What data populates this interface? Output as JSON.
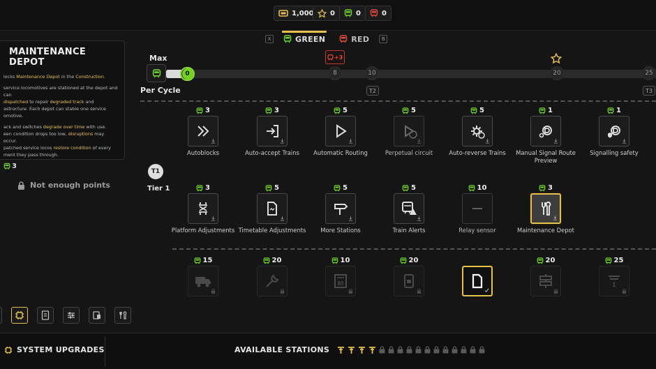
{
  "resources": {
    "coins": "1,000",
    "stars": "0",
    "green_points": "0",
    "red_points": "0"
  },
  "tabs": [
    {
      "key": "X",
      "label": "GREEN",
      "active": true
    },
    {
      "key": "B",
      "label": "RED",
      "active": false
    }
  ],
  "detail": {
    "title": "MAINTENANCE DEPOT",
    "p1_a": "locks ",
    "p1_hl": "Maintenance Depot",
    "p1_b": " in the ",
    "p1_hl2": "Construction",
    "p1_c": ".",
    "p2_a": "service locomotives are stationed at the depot and can",
    "p2_hl": "dispatched",
    "p2_b": " to repair ",
    "p2_hl2": "degraded track",
    "p2_c": " and",
    "p2_d": "astructure. Each depot can stable one service",
    "p2_e": "omotive.",
    "p3_a": "ack and switches ",
    "p3_hl": "degrade over time",
    "p3_b": " with use.",
    "p3_c": "een condition drops too low, ",
    "p3_hl2": "disruptions",
    "p3_d": " may occur.",
    "p3_e": "patched service locos ",
    "p3_hl3": "restore condition",
    "p3_f": " of every",
    "p3_g": "ment they pass through.",
    "cost": "3",
    "status": "Not enough points"
  },
  "progress": {
    "max_label": "Max",
    "per_cycle_label": "Per Cycle",
    "current": "0",
    "bonus": "+3",
    "ticks": [
      "8",
      "10",
      "20",
      "25"
    ],
    "tier_badges": [
      "T2",
      "T3"
    ]
  },
  "tier": {
    "badge": "T1",
    "label": "Tier 1"
  },
  "row1": [
    {
      "cost": "3",
      "label": "Autoblocks",
      "icon": "chevrons-icon"
    },
    {
      "cost": "3",
      "label": "Auto-accept Trains",
      "icon": "enter-icon"
    },
    {
      "cost": "5",
      "label": "Automatic Routing",
      "icon": "play-icon"
    },
    {
      "cost": "5",
      "label": "Perpetual circuit",
      "icon": "loop-play-icon"
    },
    {
      "cost": "5",
      "label": "Auto-reverse Trains",
      "icon": "gear-reverse-icon"
    },
    {
      "cost": "1",
      "label": "Manual Signal Route Preview",
      "icon": "signal-route-icon"
    },
    {
      "cost": "1",
      "label": "Signalling safety",
      "icon": "shield-signal-icon"
    }
  ],
  "row2": [
    {
      "cost": "3",
      "label": "Platform Adjustments",
      "icon": "shuffle-icon"
    },
    {
      "cost": "5",
      "label": "Timetable Adjustments",
      "icon": "document-icon"
    },
    {
      "cost": "5",
      "label": "More Stations",
      "icon": "signpost-icon"
    },
    {
      "cost": "5",
      "label": "Train Alerts",
      "icon": "train-alert-icon"
    },
    {
      "cost": "10",
      "label": "Relay sensor",
      "icon": "dash-icon"
    },
    {
      "cost": "3",
      "label": "Maintenance Depot",
      "icon": "wrench-icon"
    }
  ],
  "row3": [
    {
      "cost": "15",
      "icon": "truck-icon"
    },
    {
      "cost": "20",
      "icon": "wrench-icon"
    },
    {
      "cost": "10",
      "icon": "speed-80-icon"
    },
    {
      "cost": "20",
      "icon": "phone-icon"
    },
    {
      "cost": "",
      "icon": "document-icon"
    },
    {
      "cost": "20",
      "icon": "signpost-icon"
    },
    {
      "cost": "25",
      "icon": "platform-1-icon"
    }
  ],
  "bottom": {
    "system_upgrades": "SYSTEM UPGRADES",
    "available_stations": "AVAILABLE STATIONS",
    "stations_unlocked": 4,
    "stations_locked": 12
  },
  "colors": {
    "accent": "#e8c14a",
    "green": "#6fd12a",
    "red": "#e04a3a"
  }
}
